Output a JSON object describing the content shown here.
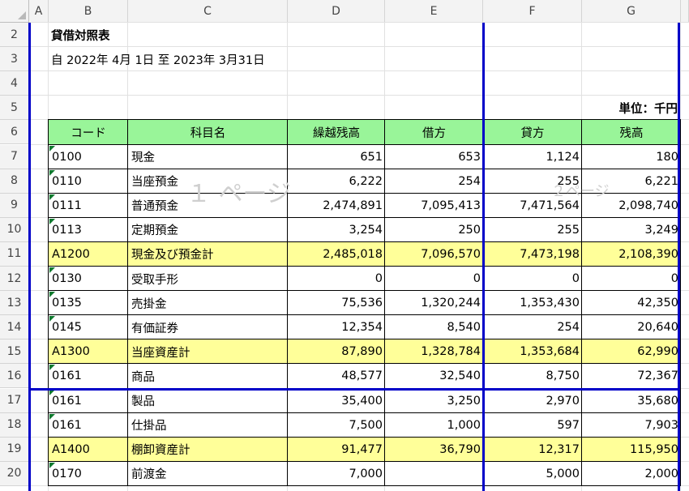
{
  "columns": [
    "A",
    "B",
    "C",
    "D",
    "E",
    "F",
    "G"
  ],
  "rows": [
    "2",
    "3",
    "4",
    "5",
    "6",
    "7",
    "8",
    "9",
    "10",
    "11",
    "12",
    "13",
    "14",
    "15",
    "16",
    "17",
    "18",
    "19",
    "20"
  ],
  "title": "貸借対照表",
  "period": "自 2022年  4月 1日  至 2023年  3月31日",
  "unit": "単位：千円",
  "headers": [
    "コード",
    "科目名",
    "繰越残高",
    "借方",
    "貸方",
    "残高"
  ],
  "watermark1": "１ ページ",
  "watermark2": "２ページ",
  "colors": {
    "header_fill": "#99f599",
    "subtotal_fill": "#ffff99",
    "page_break": "#0000c8"
  },
  "table_rows": [
    {
      "code": "0100",
      "name": "現金",
      "carry": "651",
      "debit": "653",
      "credit": "1,124",
      "balance": "180",
      "subtotal": false
    },
    {
      "code": "0110",
      "name": "当座預金",
      "carry": "6,222",
      "debit": "254",
      "credit": "255",
      "balance": "6,221",
      "subtotal": false
    },
    {
      "code": "0111",
      "name": "普通預金",
      "carry": "2,474,891",
      "debit": "7,095,413",
      "credit": "7,471,564",
      "balance": "2,098,740",
      "subtotal": false
    },
    {
      "code": "0113",
      "name": "定期預金",
      "carry": "3,254",
      "debit": "250",
      "credit": "255",
      "balance": "3,249",
      "subtotal": false
    },
    {
      "code": "A1200",
      "name": "現金及び預金計",
      "carry": "2,485,018",
      "debit": "7,096,570",
      "credit": "7,473,198",
      "balance": "2,108,390",
      "subtotal": true
    },
    {
      "code": "0130",
      "name": "受取手形",
      "carry": "0",
      "debit": "0",
      "credit": "0",
      "balance": "0",
      "subtotal": false
    },
    {
      "code": "0135",
      "name": "売掛金",
      "carry": "75,536",
      "debit": "1,320,244",
      "credit": "1,353,430",
      "balance": "42,350",
      "subtotal": false
    },
    {
      "code": "0145",
      "name": "有価証券",
      "carry": "12,354",
      "debit": "8,540",
      "credit": "254",
      "balance": "20,640",
      "subtotal": false
    },
    {
      "code": "A1300",
      "name": "当座資産計",
      "carry": "87,890",
      "debit": "1,328,784",
      "credit": "1,353,684",
      "balance": "62,990",
      "subtotal": true
    },
    {
      "code": "0161",
      "name": "商品",
      "carry": "48,577",
      "debit": "32,540",
      "credit": "8,750",
      "balance": "72,367",
      "subtotal": false
    },
    {
      "code": "0161",
      "name": "製品",
      "carry": "35,400",
      "debit": "3,250",
      "credit": "2,970",
      "balance": "35,680",
      "subtotal": false
    },
    {
      "code": "0161",
      "name": "仕掛品",
      "carry": "7,500",
      "debit": "1,000",
      "credit": "597",
      "balance": "7,903",
      "subtotal": false
    },
    {
      "code": "A1400",
      "name": "棚卸資産計",
      "carry": "91,477",
      "debit": "36,790",
      "credit": "12,317",
      "balance": "115,950",
      "subtotal": true
    },
    {
      "code": "0170",
      "name": "前渡金",
      "carry": "7,000",
      "debit": "",
      "credit": "5,000",
      "balance": "2,000",
      "subtotal": false
    }
  ]
}
